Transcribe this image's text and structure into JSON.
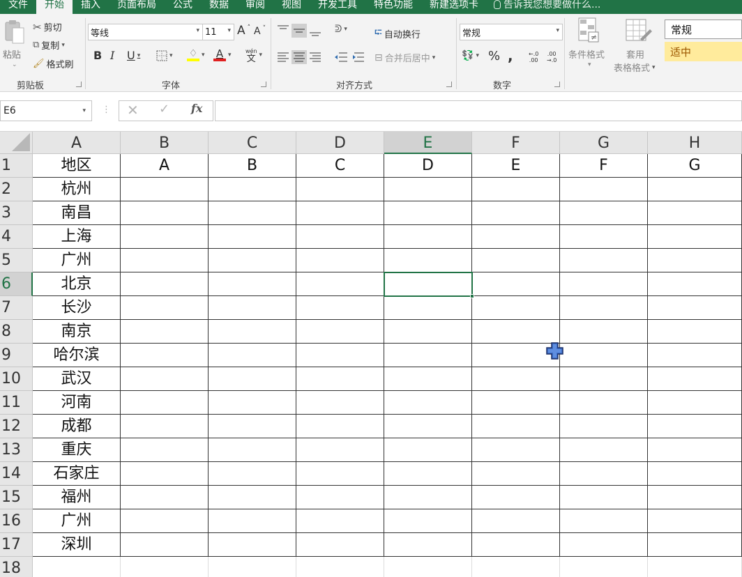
{
  "menu": {
    "tabs": [
      "文件",
      "开始",
      "插入",
      "页面布局",
      "公式",
      "数据",
      "审阅",
      "视图",
      "开发工具",
      "特色功能",
      "新建选项卡"
    ],
    "active_tab": "开始",
    "tell_me": "告诉我您想要做什么..."
  },
  "ribbon": {
    "clipboard": {
      "paste": "粘贴",
      "cut": "剪切",
      "copy": "复制",
      "format_painter": "格式刷",
      "group_label": "剪贴板"
    },
    "font": {
      "font_name": "等线",
      "font_size": "11",
      "grow": "A",
      "shrink": "A",
      "bold": "B",
      "italic": "I",
      "underline": "U",
      "font_color_letter": "A",
      "phonetic_top": "wén",
      "phonetic_bottom": "文",
      "group_label": "字体"
    },
    "alignment": {
      "wrap_text": "自动换行",
      "merge_center": "合并后居中",
      "group_label": "对齐方式"
    },
    "number": {
      "format": "常规",
      "percent": "%",
      "comma": ",",
      "inc_decimal_top": "←.0",
      "inc_decimal_bottom": ".00",
      "dec_decimal_top": ".00",
      "dec_decimal_bottom": "→.0",
      "group_label": "数字"
    },
    "styles": {
      "conditional_format": "条件格式",
      "table_format_line1": "套用",
      "table_format_line2": "表格格式",
      "style_normal": "常规",
      "style_neutral": "适中"
    }
  },
  "formula_bar": {
    "name_box": "E6",
    "fx": "fx",
    "formula": ""
  },
  "sheet": {
    "columns": [
      "A",
      "B",
      "C",
      "D",
      "E",
      "F",
      "G",
      "H"
    ],
    "rows": [
      "1",
      "2",
      "3",
      "4",
      "5",
      "6",
      "7",
      "8",
      "9",
      "10",
      "11",
      "12",
      "13",
      "14",
      "15",
      "16",
      "17",
      "18"
    ],
    "header_row": [
      "地区",
      "A",
      "B",
      "C",
      "D",
      "E",
      "F",
      "G"
    ],
    "regions": [
      "杭州",
      "南昌",
      "上海",
      "广州",
      "北京",
      "长沙",
      "南京",
      "哈尔滨",
      "武汉",
      "河南",
      "成都",
      "重庆",
      "石家庄",
      "福州",
      "广州",
      "深圳"
    ],
    "selected_cell": "E6",
    "selected_column": "E",
    "selected_row": "6"
  },
  "colors": {
    "excel_green": "#217346",
    "neutral_style_bg": "#ffeb9c",
    "neutral_style_fg": "#9c5700",
    "cursor_blue": "#3f6fc8"
  }
}
